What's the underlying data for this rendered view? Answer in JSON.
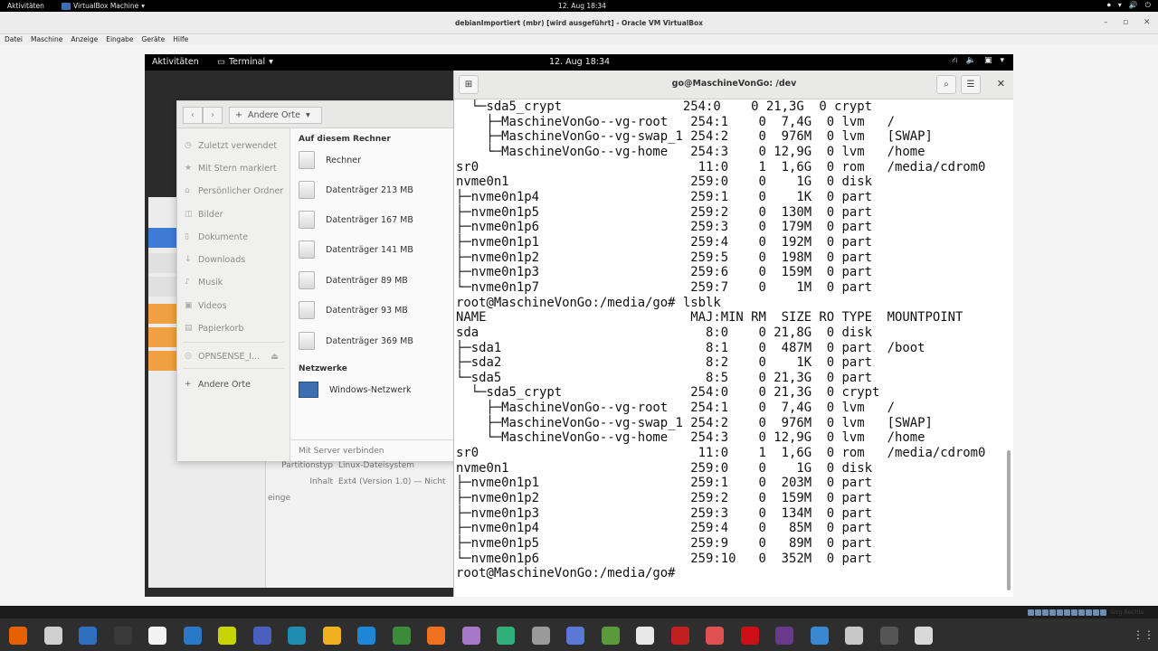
{
  "host_topbar": {
    "activities": "Aktivitäten",
    "app_menu": "VirtualBox Machine",
    "clock": "12. Aug 18:34"
  },
  "vbox": {
    "title": "debianImportiert (mbr) [wird ausgeführt] - Oracle VM VirtualBox",
    "menu": [
      "Datei",
      "Maschine",
      "Anzeige",
      "Eingabe",
      "Geräte",
      "Hilfe"
    ],
    "status_key": "Strg Rechts"
  },
  "guest_topbar": {
    "activities": "Aktivitäten",
    "app_menu": "Terminal",
    "clock": "12. Aug 18:34"
  },
  "files": {
    "path": "Andere Orte",
    "sidebar": [
      {
        "label": "Zuletzt verwendet",
        "icon": "clock-icon"
      },
      {
        "label": "Mit Stern markiert",
        "icon": "star-icon"
      },
      {
        "label": "Persönlicher Ordner",
        "icon": "home-icon"
      },
      {
        "label": "Bilder",
        "icon": "camera-icon"
      },
      {
        "label": "Dokumente",
        "icon": "document-icon"
      },
      {
        "label": "Downloads",
        "icon": "download-icon"
      },
      {
        "label": "Musik",
        "icon": "music-icon"
      },
      {
        "label": "Videos",
        "icon": "video-icon"
      },
      {
        "label": "Papierkorb",
        "icon": "trash-icon"
      },
      {
        "label": "OPNSENSE_I...",
        "icon": "disc-icon"
      },
      {
        "label": "Andere Orte",
        "icon": "plus-icon"
      }
    ],
    "section_local": "Auf diesem Rechner",
    "local_items": [
      "Rechner",
      "Datenträger 213 MB",
      "Datenträger 167 MB",
      "Datenträger 141 MB",
      "Datenträger 89 MB",
      "Datenträger 93 MB",
      "Datenträger 369 MB"
    ],
    "section_network": "Netzwerke",
    "network_items": [
      "Windows-Netzwerk"
    ],
    "footer": "Mit Server verbinden"
  },
  "disks_bg": {
    "props": [
      {
        "key": "Partitionstyp",
        "value": "Linux-Dateisystem"
      },
      {
        "key": "Inhalt",
        "value": "Ext4 (Version 1.0) — Nicht einge"
      }
    ]
  },
  "terminal": {
    "title": "go@MaschineVonGo: /dev",
    "lines": [
      "  └─sda5_crypt                254:0    0 21,3G  0 crypt",
      "    ├─MaschineVonGo--vg-root   254:1    0  7,4G  0 lvm   /",
      "    ├─MaschineVonGo--vg-swap_1 254:2    0  976M  0 lvm   [SWAP]",
      "    └─MaschineVonGo--vg-home   254:3    0 12,9G  0 lvm   /home",
      "sr0                             11:0    1  1,6G  0 rom   /media/cdrom0",
      "nvme0n1                        259:0    0    1G  0 disk",
      "├─nvme0n1p4                    259:1    0    1K  0 part",
      "├─nvme0n1p5                    259:2    0  130M  0 part",
      "├─nvme0n1p6                    259:3    0  179M  0 part",
      "├─nvme0n1p1                    259:4    0  192M  0 part",
      "├─nvme0n1p2                    259:5    0  198M  0 part",
      "├─nvme0n1p3                    259:6    0  159M  0 part",
      "└─nvme0n1p7                    259:7    0    1M  0 part",
      "root@MaschineVonGo:/media/go# lsblk",
      "NAME                           MAJ:MIN RM  SIZE RO TYPE  MOUNTPOINT",
      "sda                              8:0    0 21,8G  0 disk",
      "├─sda1                           8:1    0  487M  0 part  /boot",
      "├─sda2                           8:2    0    1K  0 part",
      "└─sda5                           8:5    0 21,3G  0 part",
      "  └─sda5_crypt                 254:0    0 21,3G  0 crypt",
      "    ├─MaschineVonGo--vg-root   254:1    0  7,4G  0 lvm   /",
      "    ├─MaschineVonGo--vg-swap_1 254:2    0  976M  0 lvm   [SWAP]",
      "    └─MaschineVonGo--vg-home   254:3    0 12,9G  0 lvm   /home",
      "sr0                             11:0    1  1,6G  0 rom   /media/cdrom0",
      "nvme0n1                        259:0    0    1G  0 disk",
      "├─nvme0n1p1                    259:1    0  203M  0 part",
      "├─nvme0n1p2                    259:2    0  159M  0 part",
      "├─nvme0n1p3                    259:3    0  134M  0 part",
      "├─nvme0n1p4                    259:4    0   85M  0 part",
      "├─nvme0n1p5                    259:9    0   89M  0 part",
      "└─nvme0n1p6                    259:10   0  352M  0 part",
      "root@MaschineVonGo:/media/go# "
    ]
  },
  "dock": {
    "apps": [
      {
        "name": "firefox-icon",
        "color": "#e66000"
      },
      {
        "name": "files-icon",
        "color": "#cfcfcf"
      },
      {
        "name": "writer-icon",
        "color": "#2f6fbf"
      },
      {
        "name": "terminal-icon",
        "color": "#3a3a3a"
      },
      {
        "name": "text-editor-icon",
        "color": "#f2f2f2"
      },
      {
        "name": "diagram-icon",
        "color": "#2a78c8"
      },
      {
        "name": "chart-icon",
        "color": "#c8d400"
      },
      {
        "name": "network-icon",
        "color": "#4a5fc0"
      },
      {
        "name": "scope-icon",
        "color": "#1c8cb0"
      },
      {
        "name": "archive-icon",
        "color": "#f0b020"
      },
      {
        "name": "vscode-icon",
        "color": "#1d86d6"
      },
      {
        "name": "globe-icon",
        "color": "#3b8b3b"
      },
      {
        "name": "software-icon",
        "color": "#f07020"
      },
      {
        "name": "browser-icon",
        "color": "#a878c8"
      },
      {
        "name": "xmind-icon",
        "color": "#2fb07a"
      },
      {
        "name": "settings-icon",
        "color": "#9a9a9a"
      },
      {
        "name": "window-icon",
        "color": "#5a78d8"
      },
      {
        "name": "gnome-icon",
        "color": "#5a9a3a"
      },
      {
        "name": "check-icon",
        "color": "#e8e8e8"
      },
      {
        "name": "filezilla-icon",
        "color": "#c02020"
      },
      {
        "name": "puzzle-icon",
        "color": "#e05050"
      },
      {
        "name": "opera-icon",
        "color": "#cc0f16"
      },
      {
        "name": "video-icon",
        "color": "#6a3a8a"
      },
      {
        "name": "gear-blue-icon",
        "color": "#3a88d0"
      },
      {
        "name": "search-icon",
        "color": "#c8c8c8"
      },
      {
        "name": "blank-icon",
        "color": "#555555"
      },
      {
        "name": "tray-icon",
        "color": "#d8d8d8"
      }
    ]
  }
}
